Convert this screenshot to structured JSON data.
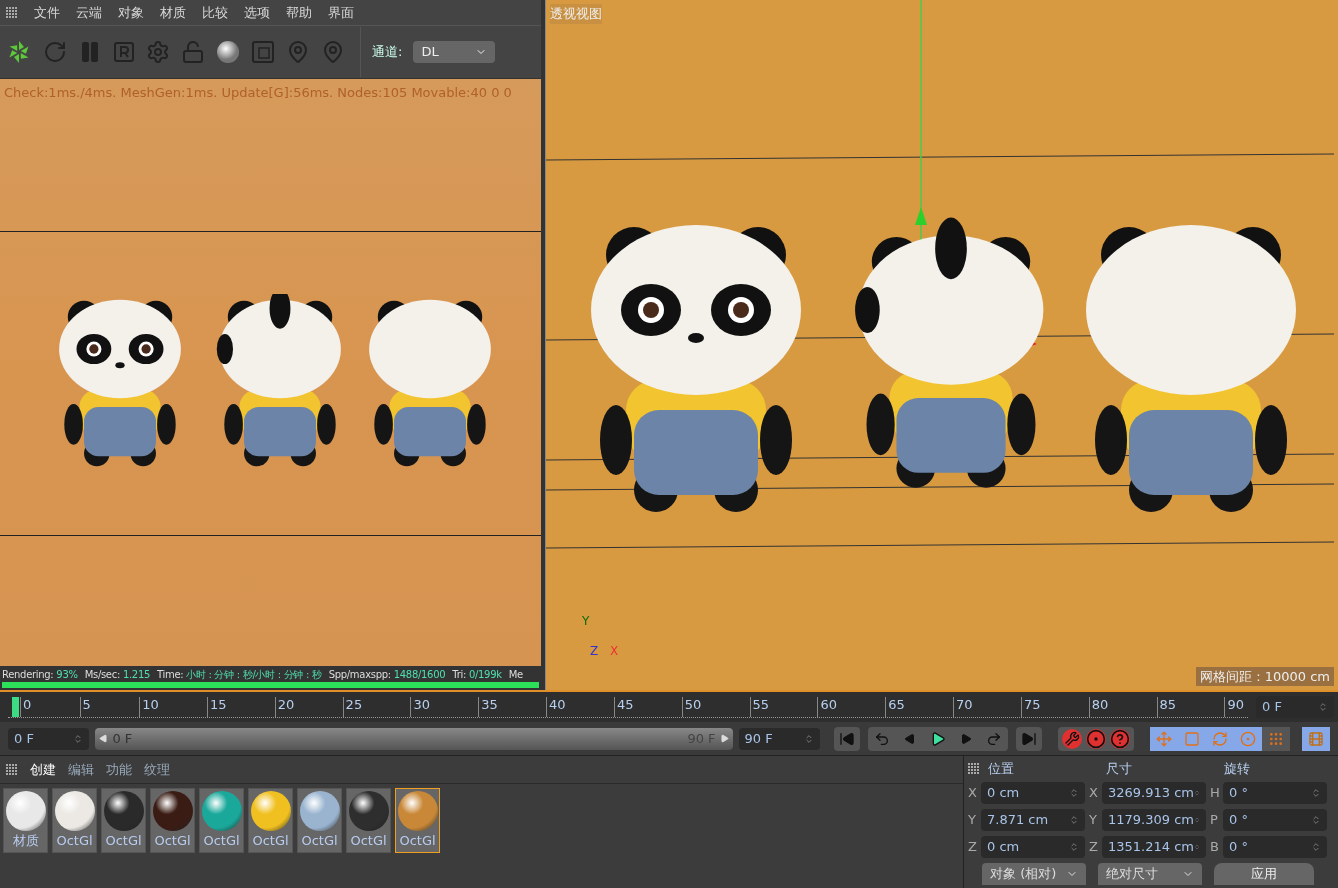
{
  "menu": [
    {
      "label": "文件"
    },
    {
      "label": "云端"
    },
    {
      "label": "对象"
    },
    {
      "label": "材质"
    },
    {
      "label": "比较"
    },
    {
      "label": "选项"
    },
    {
      "label": "帮助"
    },
    {
      "label": "界面"
    }
  ],
  "channel": {
    "label": "通道:",
    "value": "DL"
  },
  "render_view": {
    "stats": "Check:1ms./4ms. MeshGen:1ms. Update[G]:56ms. Nodes:105 Movable:40  0 0",
    "status": [
      {
        "label": "Rendering:",
        "value": "93%"
      },
      {
        "label": "Ms/sec:",
        "value": "1.215"
      },
      {
        "label": "Time:",
        "value": "小时 : 分钟 : 秒/小时 : 分钟 : 秒"
      },
      {
        "label": "Spp/maxspp:",
        "value": "1488/1600"
      },
      {
        "label": "Tri:",
        "value": "0/199k"
      },
      {
        "label": "Me"
      }
    ],
    "progress": {
      "level": 1
    }
  },
  "viewport": {
    "title": "透视视图",
    "grid_spacing": "网格间距 : 10000 cm",
    "axis_y": "Y",
    "axis_z": "Z",
    "axis_x": "X"
  },
  "timeline": {
    "ticks": [
      "0",
      "5",
      "10",
      "15",
      "20",
      "25",
      "30",
      "35",
      "40",
      "45",
      "50",
      "55",
      "60",
      "65",
      "70",
      "75",
      "80",
      "85",
      "90"
    ],
    "current_frame": "0 F",
    "range_bar": {
      "level": 1
    },
    "start_field": "0 F",
    "range_start": "0 F",
    "range_end": "90 F",
    "end_field": "90 F",
    "playing": true,
    "key_modes": [
      {
        "kind": "move",
        "selected": true
      },
      {
        "kind": "scale",
        "selected": true
      },
      {
        "kind": "rotate",
        "selected": true
      },
      {
        "kind": "param",
        "selected": true
      },
      {
        "kind": "points",
        "selected": false
      }
    ],
    "film_selected": true
  },
  "materials": {
    "tabs": [
      {
        "label": "创建",
        "selected": true
      },
      {
        "label": "编辑",
        "selected": false
      },
      {
        "label": "功能",
        "selected": false
      },
      {
        "label": "纹理",
        "selected": false
      }
    ],
    "swatches": [
      {
        "name": "材质",
        "color": "#e8e8e8",
        "selected": false
      },
      {
        "name": "OctGl",
        "color": "#ece9e4",
        "selected": false
      },
      {
        "name": "OctGl",
        "color": "#2a2a2a",
        "selected": false
      },
      {
        "name": "OctGl",
        "color": "#3a1c14",
        "selected": false
      },
      {
        "name": "OctGl",
        "color": "#1aa89a",
        "selected": false
      },
      {
        "name": "OctGl",
        "color": "#f0c020",
        "selected": false
      },
      {
        "name": "OctGl",
        "color": "#9ab4d0",
        "selected": false
      },
      {
        "name": "OctGl",
        "color": "#2e2e2e",
        "selected": false
      },
      {
        "name": "OctGl",
        "color": "#c88838",
        "selected": true
      }
    ]
  },
  "coordinates": {
    "headers": [
      "位置",
      "尺寸",
      "旋转"
    ],
    "columns": [
      [
        {
          "axis": "X",
          "value": "0 cm"
        },
        {
          "axis": "Y",
          "value": "7.871 cm"
        },
        {
          "axis": "Z",
          "value": "0 cm"
        }
      ],
      [
        {
          "axis": "X",
          "value": "3269.913 cm"
        },
        {
          "axis": "Y",
          "value": "1179.309 cm"
        },
        {
          "axis": "Z",
          "value": "1351.214 cm"
        }
      ],
      [
        {
          "axis": "H",
          "value": "0 °"
        },
        {
          "axis": "P",
          "value": "0 °"
        },
        {
          "axis": "B",
          "value": "0 °"
        }
      ]
    ],
    "mode_dropdown": "对象 (相对)",
    "size_dropdown": "绝对尺寸",
    "apply": "应用"
  }
}
